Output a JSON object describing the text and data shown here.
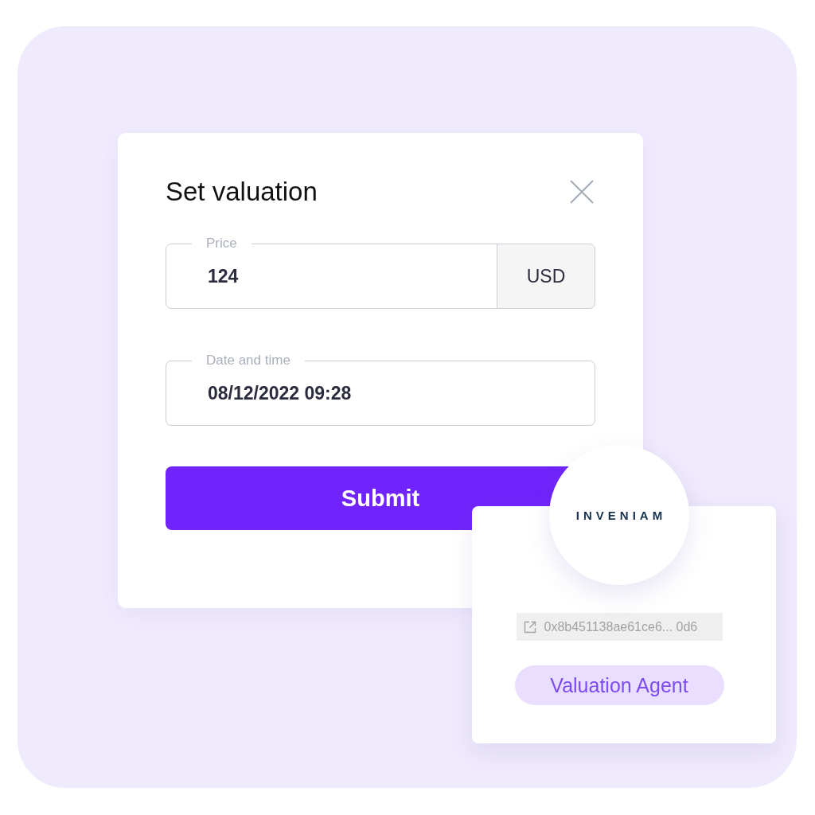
{
  "dialog": {
    "title": "Set valuation",
    "fields": [
      {
        "kind": "amount",
        "label": "Price",
        "value": "124",
        "unit": "USD"
      },
      {
        "kind": "text",
        "label": "Date and time",
        "value": "08/12/2022 09:28"
      }
    ],
    "submit": "Submit"
  },
  "agent_card": {
    "logo_text": "INVENIAM",
    "address": "0x8b451138ae61ce6... 0d6",
    "role": "Valuation Agent"
  }
}
